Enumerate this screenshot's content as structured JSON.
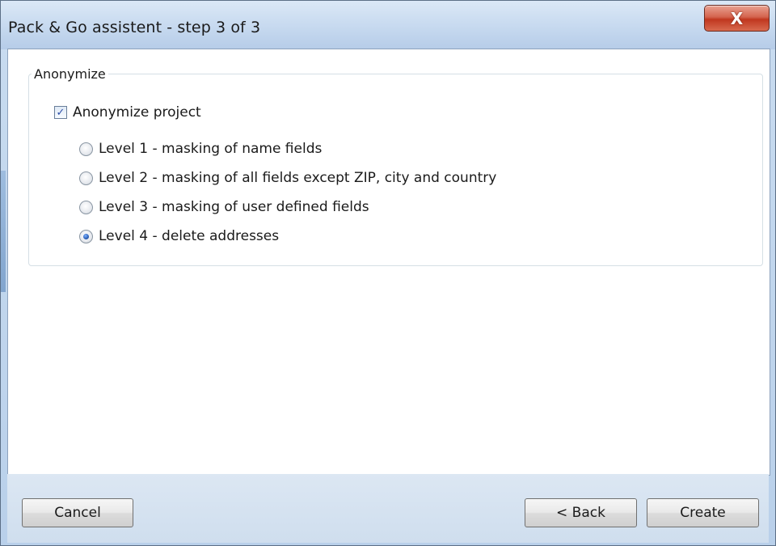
{
  "window": {
    "title": "Pack & Go assistent - step 3 of 3",
    "close_symbol": "X"
  },
  "group": {
    "legend": "Anonymize",
    "checkbox": {
      "label": "Anonymize project",
      "checked": true,
      "check_symbol": "✓"
    },
    "levels": [
      {
        "label": "Level 1 - masking of name fields",
        "selected": false
      },
      {
        "label": "Level 2 - masking of all fields except ZIP, city and country",
        "selected": false
      },
      {
        "label": "Level 3 - masking of user defined fields",
        "selected": false
      },
      {
        "label": "Level 4 - delete addresses",
        "selected": true
      }
    ]
  },
  "buttons": {
    "cancel": "Cancel",
    "back": "< Back",
    "create": "Create"
  }
}
